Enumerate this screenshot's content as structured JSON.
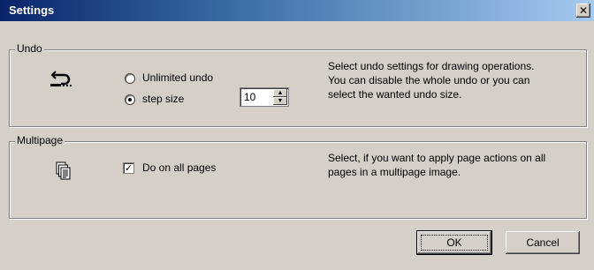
{
  "window": {
    "title": "Settings",
    "close_glyph": "✕"
  },
  "undo": {
    "group_label": "Undo",
    "icon": "undo-icon",
    "options": [
      {
        "label": "Unlimited undo",
        "checked": false
      },
      {
        "label": "step size",
        "checked": true
      }
    ],
    "step_size_value": "10",
    "spin_up": "▲",
    "spin_down": "▼",
    "description": [
      "Select undo settings for drawing operations.",
      "You can disable the whole undo or you can",
      "select the wanted undo size."
    ]
  },
  "multipage": {
    "group_label": "Multipage",
    "icon": "multipage-icon",
    "checkbox_label": "Do on all pages",
    "checked": true,
    "check_glyph": "✓",
    "description": [
      "Select, if you want to apply page actions on all",
      "pages in a multipage image."
    ]
  },
  "buttons": {
    "ok": "OK",
    "cancel": "Cancel"
  }
}
